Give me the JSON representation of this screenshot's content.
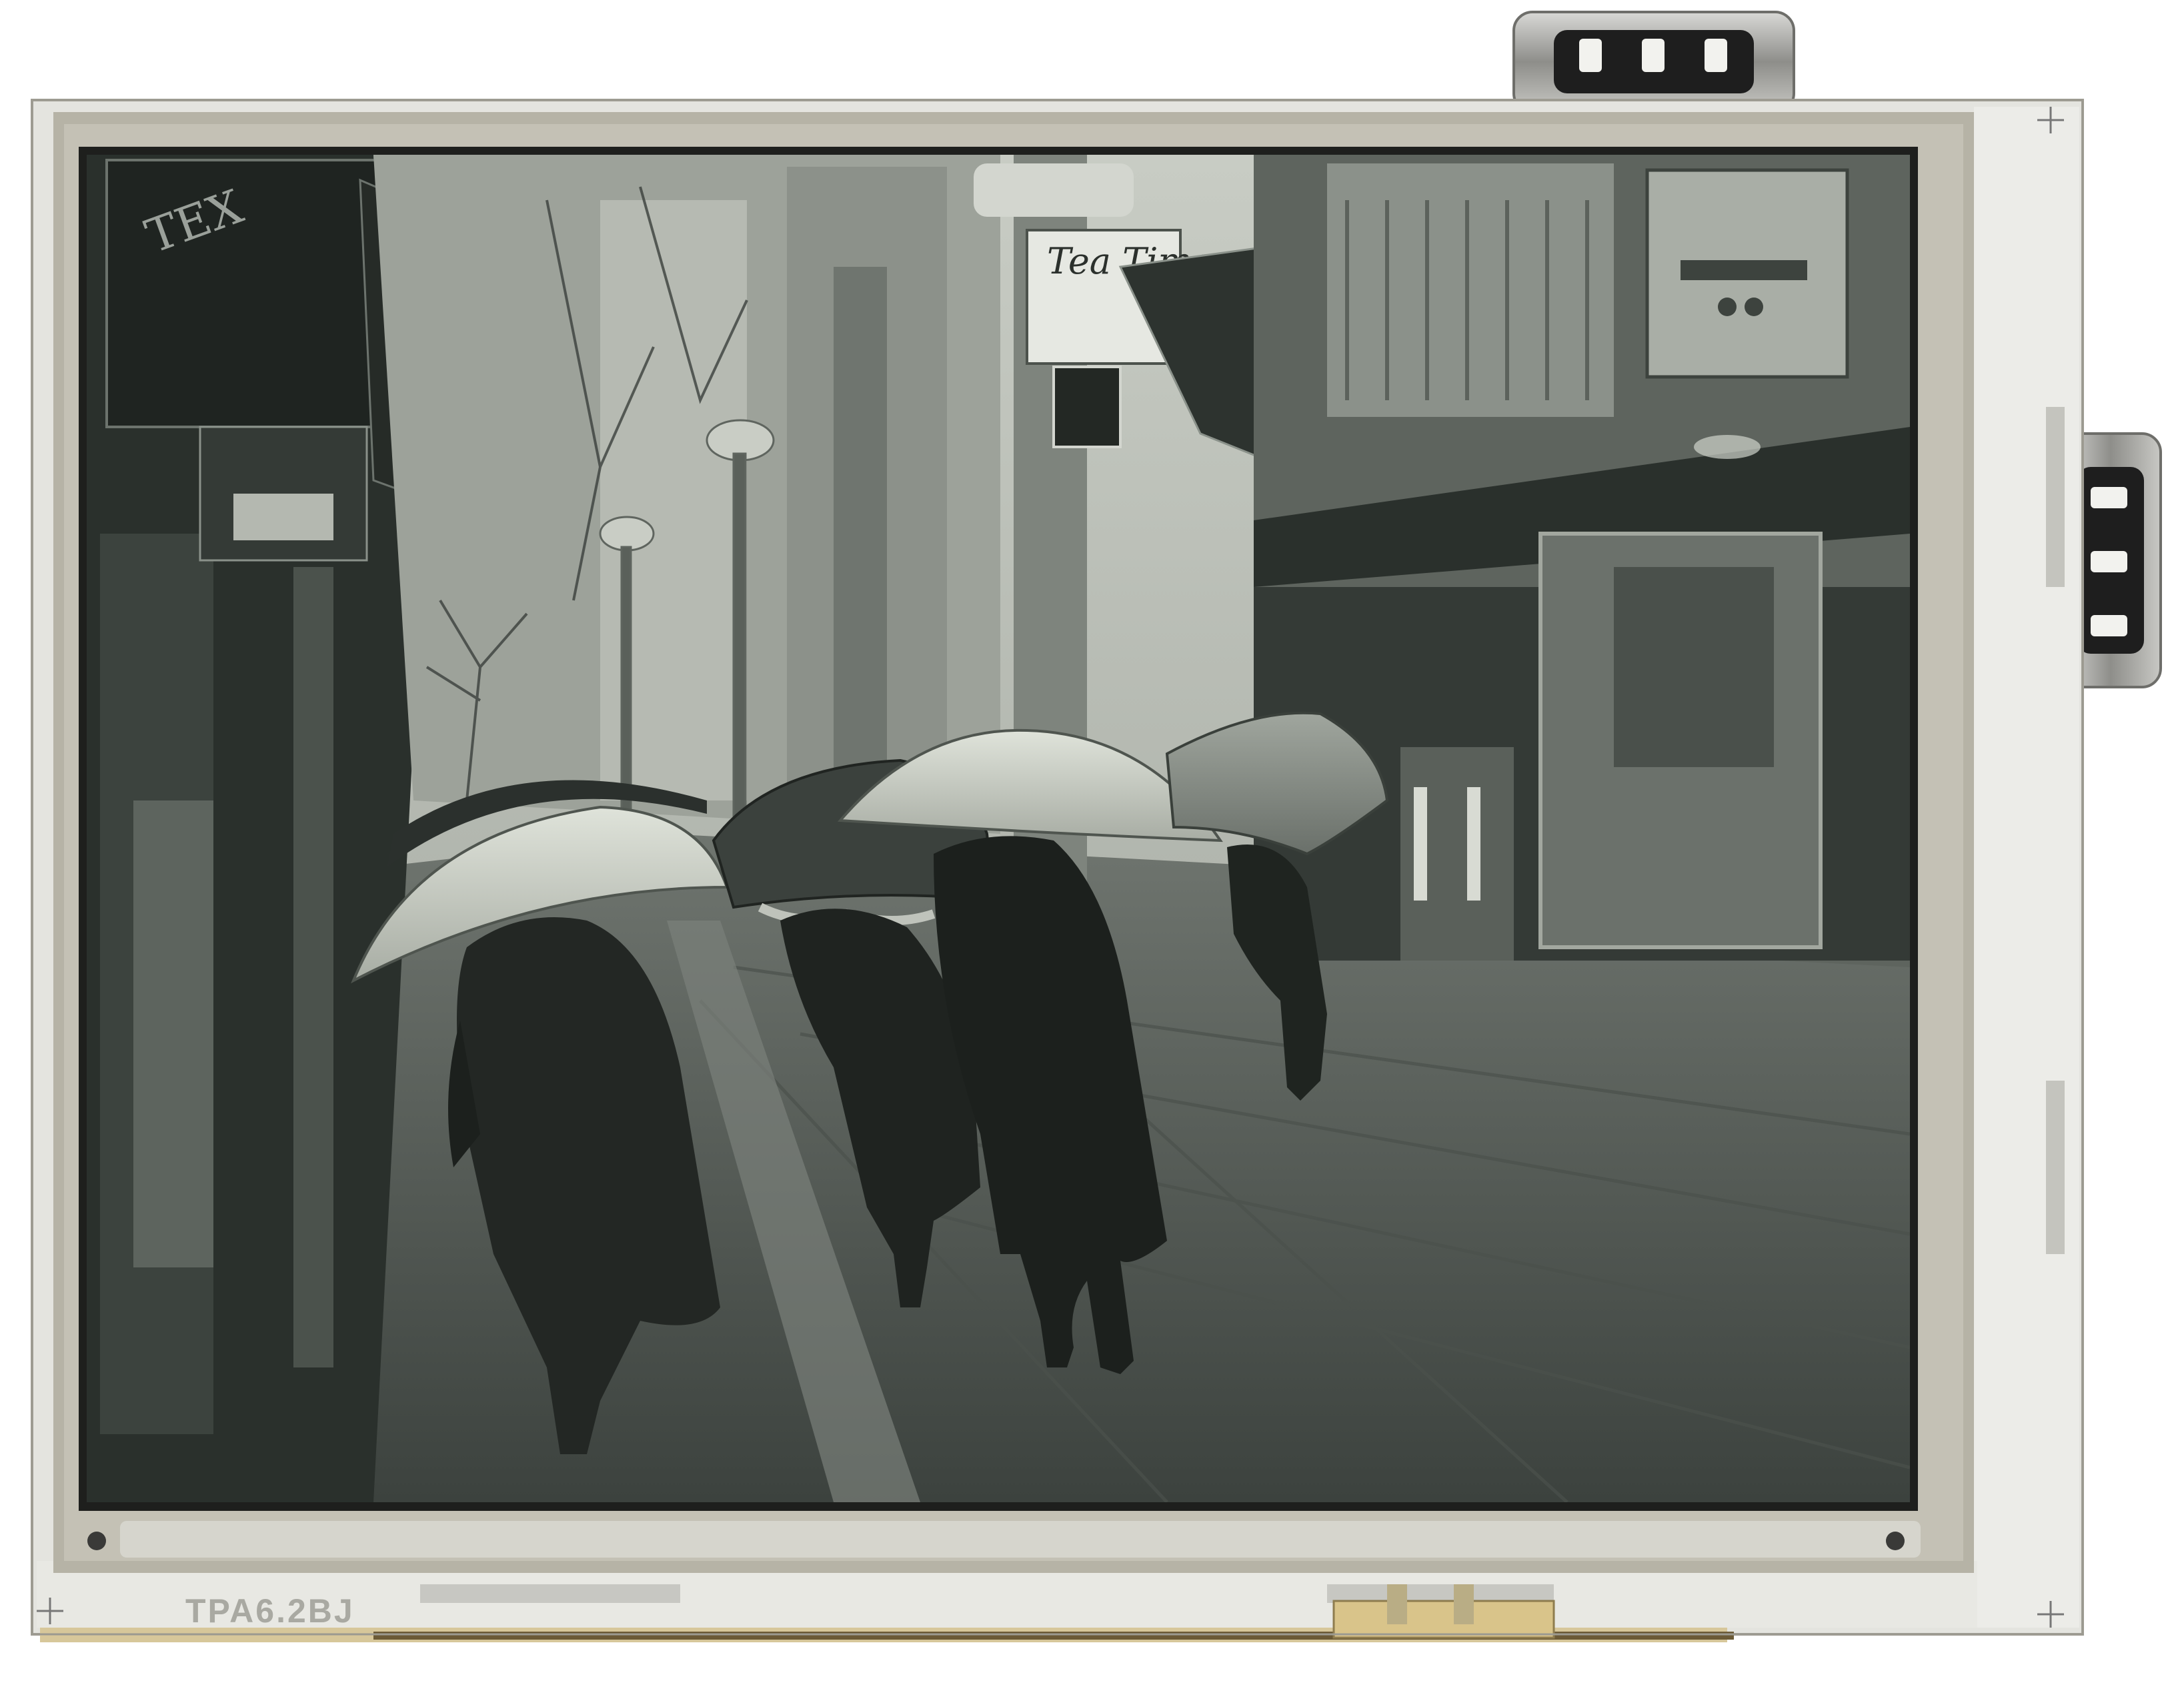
{
  "device": {
    "part_code": "TPA6.2BJ"
  },
  "scene": {
    "signs": {
      "tea_shop": "Tea Time"
    }
  },
  "colors": {
    "glass_frame": "#b3b0a4",
    "glass_light": "#e2e2dc",
    "screen_dark": "#222824",
    "screen_mid": "#5b615c",
    "screen_light": "#b8bcb3",
    "connector_metal": "#9b9b96"
  }
}
